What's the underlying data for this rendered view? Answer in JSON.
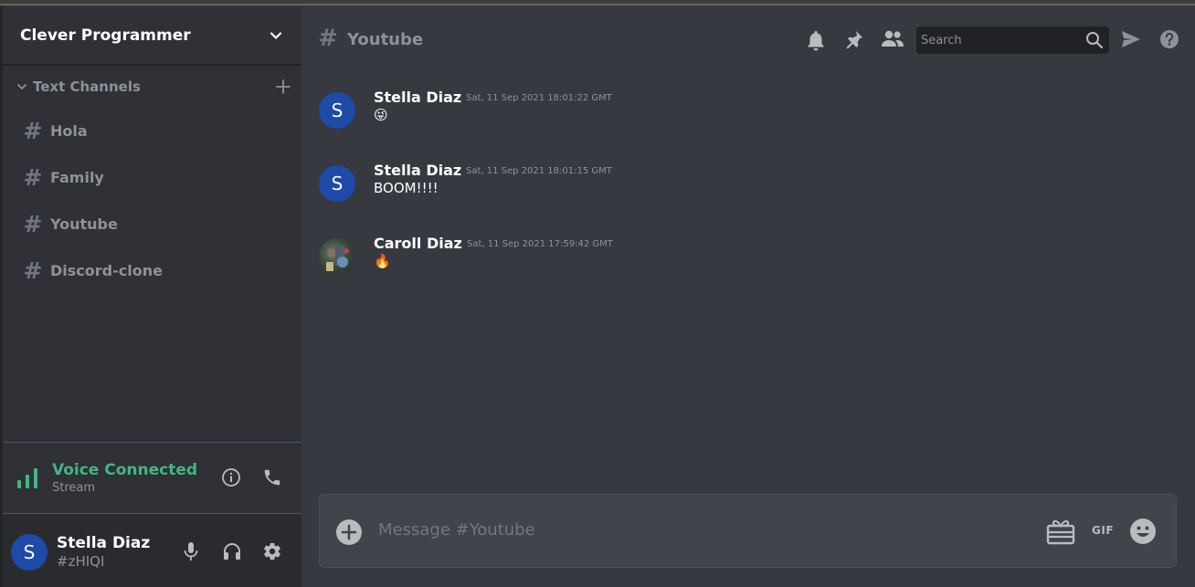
{
  "server": {
    "name": "Clever Programmer",
    "menu_icon": "chevron-down-icon"
  },
  "sidebar": {
    "section_title": "Text Channels",
    "channels": [
      {
        "label": "Hola"
      },
      {
        "label": "Family"
      },
      {
        "label": "Youtube"
      },
      {
        "label": "Discord-clone"
      }
    ]
  },
  "voice": {
    "status": "Voice Connected",
    "sub": "Stream",
    "accent": "#43b581"
  },
  "user": {
    "name": "Stella Diaz",
    "tag": "#zHIQI",
    "avatar_letter": "S",
    "avatar_color": "#1e4aa8"
  },
  "header": {
    "channel": "Youtube",
    "search_placeholder": "Search",
    "icons": [
      "bell-icon",
      "pin-icon",
      "members-icon",
      "search-icon",
      "send-icon",
      "help-icon"
    ]
  },
  "messages": [
    {
      "author": "Stella Diaz",
      "timestamp": "Sat, 11 Sep 2021 18:01:22 GMT",
      "text": "😜",
      "avatar_letter": "S"
    },
    {
      "author": "Stella Diaz",
      "timestamp": "Sat, 11 Sep 2021 18:01:15 GMT",
      "text": "BOOM!!!!",
      "avatar_letter": "S"
    },
    {
      "author": "Caroll Diaz",
      "timestamp": "Sat, 11 Sep 2021 17:59:42 GMT",
      "text": "🔥",
      "avatar_letter": ""
    }
  ],
  "composer": {
    "placeholder": "Message #Youtube",
    "gif_label": "GIF"
  }
}
